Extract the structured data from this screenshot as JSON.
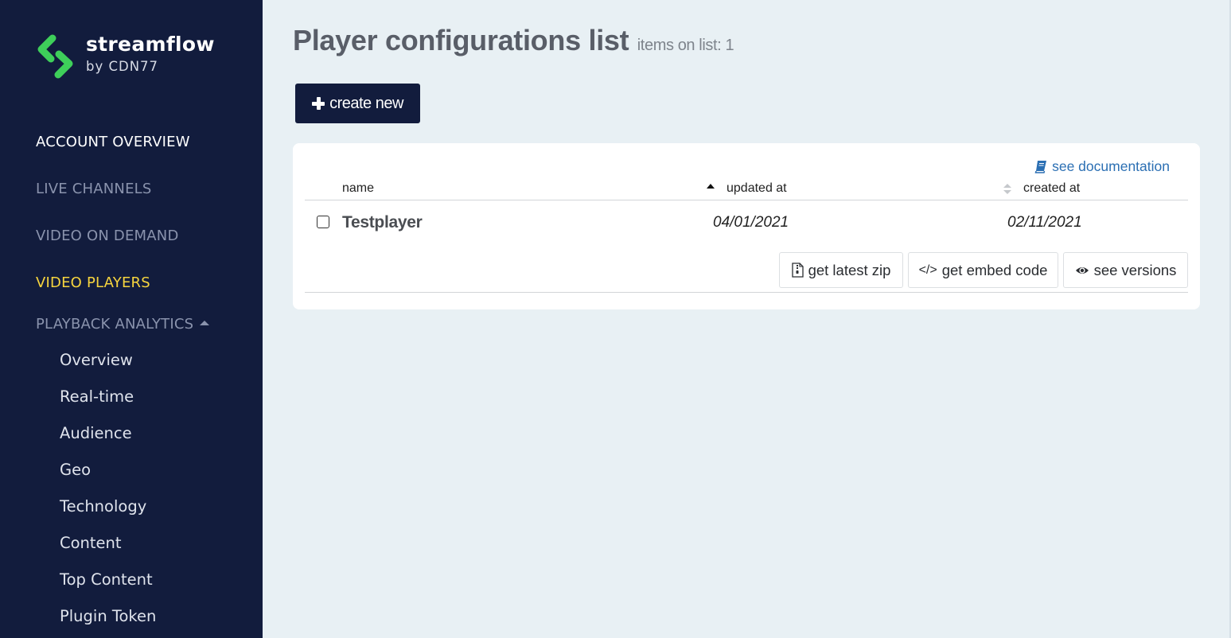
{
  "brand": {
    "name": "streamflow",
    "sub": "by CDN77",
    "colors": {
      "logo_green": "#3ecf5a",
      "sidebar_bg": "#121c3d",
      "active": "#f7d53e",
      "link": "#2b6fb3"
    }
  },
  "sidebar": {
    "items": [
      {
        "label": "ACCOUNT OVERVIEW",
        "state": "normal"
      },
      {
        "label": "LIVE CHANNELS",
        "state": "muted"
      },
      {
        "label": "VIDEO ON DEMAND",
        "state": "muted"
      },
      {
        "label": "VIDEO PLAYERS",
        "state": "active"
      },
      {
        "label": "PLAYBACK ANALYTICS",
        "state": "expanded",
        "icon": "caret-up-icon"
      }
    ],
    "subitems": [
      {
        "label": "Overview"
      },
      {
        "label": "Real-time"
      },
      {
        "label": "Audience"
      },
      {
        "label": "Geo"
      },
      {
        "label": "Technology"
      },
      {
        "label": "Content"
      },
      {
        "label": "Top Content"
      },
      {
        "label": "Plugin Token"
      }
    ]
  },
  "header": {
    "title": "Player configurations list",
    "count_text": "items on list: 1"
  },
  "toolbar": {
    "create_label": "create new",
    "create_icon": "plus-icon"
  },
  "table": {
    "doc_link": {
      "label": "see documentation",
      "icon": "book-icon"
    },
    "columns": [
      {
        "label": "name"
      },
      {
        "label": "updated at",
        "sort": "ascending"
      },
      {
        "label": "created at",
        "sort": "none"
      }
    ],
    "rows": [
      {
        "checked": false,
        "name": "Testplayer",
        "updated_at": "04/01/2021",
        "created_at": "02/11/2021",
        "actions": [
          {
            "label": "get latest zip",
            "icon": "zip-file-icon"
          },
          {
            "label": "get embed code",
            "icon": "code-icon"
          },
          {
            "label": "see versions",
            "icon": "eye-icon"
          }
        ]
      }
    ]
  }
}
